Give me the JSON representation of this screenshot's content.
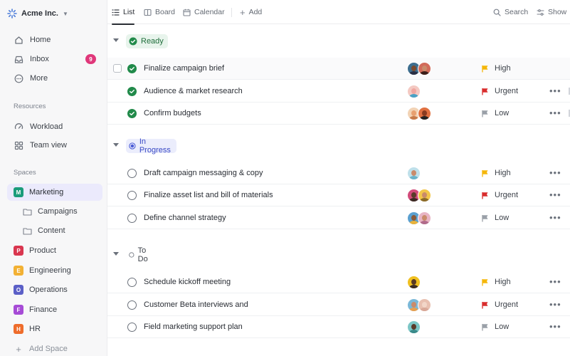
{
  "workspace": {
    "name": "Acme Inc."
  },
  "sidebar": {
    "nav": [
      {
        "label": "Home",
        "icon": "home-icon"
      },
      {
        "label": "Inbox",
        "icon": "inbox-icon",
        "badge": "9"
      },
      {
        "label": "More",
        "icon": "more-circle-icon"
      }
    ],
    "resources_label": "Resources",
    "resources": [
      {
        "label": "Workload",
        "icon": "workload-icon"
      },
      {
        "label": "Team view",
        "icon": "team-view-icon"
      }
    ],
    "spaces_label": "Spaces",
    "spaces": [
      {
        "label": "Marketing",
        "letter": "M",
        "color": "#1a9c7a"
      },
      {
        "label": "Product",
        "letter": "P",
        "color": "#d9364f"
      },
      {
        "label": "Engineering",
        "letter": "E",
        "color": "#f2b134"
      },
      {
        "label": "Operations",
        "letter": "O",
        "color": "#5b5fc7"
      },
      {
        "label": "Finance",
        "letter": "F",
        "color": "#a64bd6"
      },
      {
        "label": "HR",
        "letter": "H",
        "color": "#ee6c2b"
      }
    ],
    "folders": [
      {
        "label": "Campaigns"
      },
      {
        "label": "Content"
      }
    ],
    "add_space": "Add Space"
  },
  "toolbar": {
    "tabs": [
      {
        "label": "List"
      },
      {
        "label": "Board"
      },
      {
        "label": "Calendar"
      }
    ],
    "add_label": "Add",
    "search_label": "Search",
    "show_label": "Show"
  },
  "groups": [
    {
      "name": "Ready",
      "tasks": [
        {
          "title": "Finalize campaign brief",
          "priority": "High",
          "flag_color": "#f5b70a",
          "avatars": [
            "#7a4a2e",
            "#c98b6b"
          ]
        },
        {
          "title": "Audience & market research",
          "priority": "Urgent",
          "flag_color": "#d92d2d",
          "avatars": [
            "#f0a6a0"
          ]
        },
        {
          "title": "Confirm budgets",
          "priority": "Low",
          "flag_color": "#9aa0a8",
          "avatars": [
            "#e8a070",
            "#8a3b1f"
          ]
        }
      ]
    },
    {
      "name": "In Progress",
      "tasks": [
        {
          "title": "Draft campaign messaging & copy",
          "priority": "High",
          "flag_color": "#f5b70a",
          "avatars": [
            "#6ab3c9"
          ]
        },
        {
          "title": "Finalize asset list and bill of materials",
          "priority": "Urgent",
          "flag_color": "#d92d2d",
          "avatars": [
            "#3a2a22",
            "#e9b23a"
          ]
        },
        {
          "title": "Define channel strategy",
          "priority": "Low",
          "flag_color": "#9aa0a8",
          "avatars": [
            "#5aa0d0",
            "#e8b4c4"
          ]
        }
      ]
    },
    {
      "name": "To Do",
      "tasks": [
        {
          "title": "Schedule kickoff meeting",
          "priority": "High",
          "flag_color": "#f5b70a",
          "avatars": [
            "#f0c020"
          ]
        },
        {
          "title": "Customer Beta interviews and",
          "priority": "Urgent",
          "flag_color": "#d92d2d",
          "avatars": [
            "#7ab8d8",
            "#e8c0b0"
          ]
        },
        {
          "title": "Field marketing support plan",
          "priority": "Low",
          "flag_color": "#9aa0a8",
          "avatars": [
            "#7cc6c6"
          ]
        }
      ]
    }
  ]
}
